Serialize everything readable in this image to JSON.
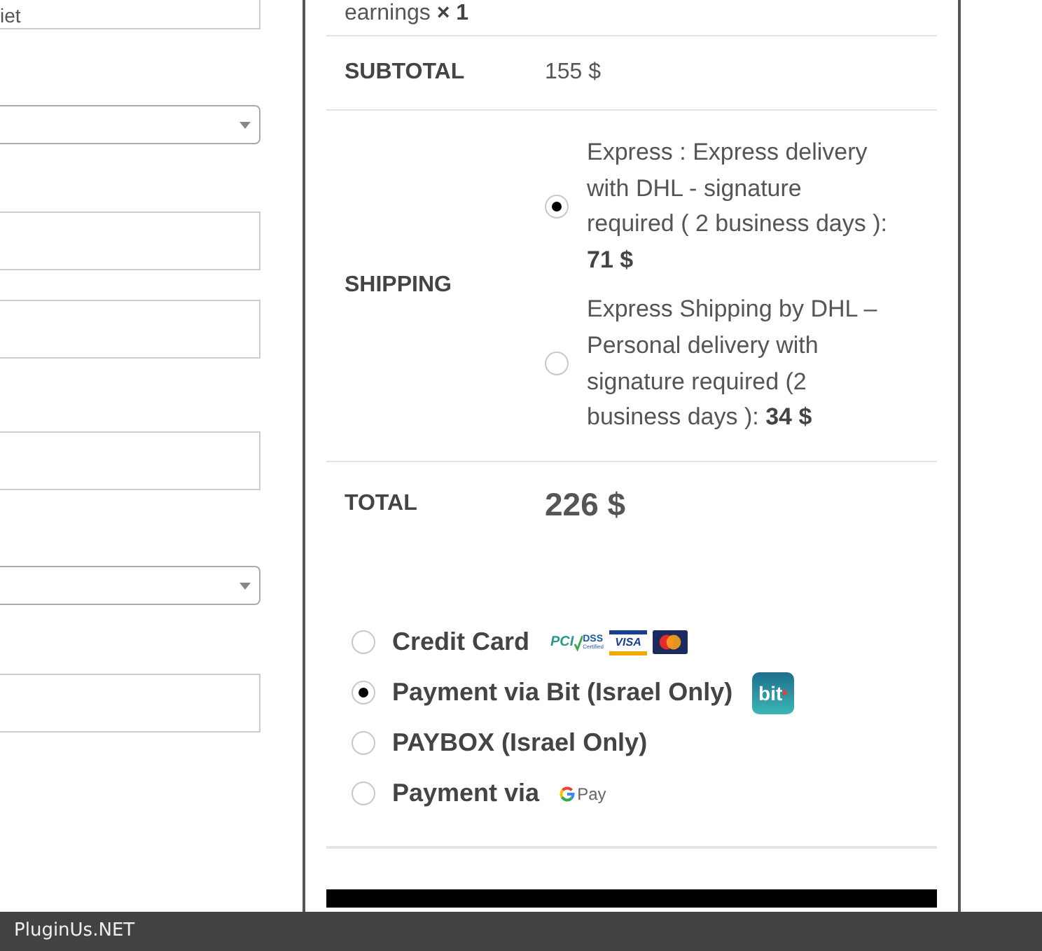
{
  "left_form": {
    "fields": [
      {
        "kind": "input",
        "value": "iet"
      },
      {
        "kind": "select"
      },
      {
        "kind": "input"
      },
      {
        "kind": "input"
      },
      {
        "kind": "input"
      },
      {
        "kind": "select"
      },
      {
        "kind": "input"
      }
    ]
  },
  "order_review": {
    "cart_item": {
      "name": "earnings",
      "quantity": "× 1"
    },
    "subtotal": {
      "label": "SUBTOTAL",
      "value": "155 $"
    },
    "shipping": {
      "label": "SHIPPING",
      "options": [
        {
          "text": "Express : Express delivery with DHL - signature required ( 2 business days ): **71 $**",
          "selected": true
        },
        {
          "text": "Express Shipping by DHL – Personal delivery with signature required (2 business days ): **34 $**",
          "selected": false
        }
      ]
    },
    "total": {
      "label": "TOTAL",
      "value": "226 $"
    }
  },
  "payment_methods": [
    {
      "label": "Credit Card",
      "selected": false,
      "logos": [
        {
          "kind": "pci",
          "text": "PCI",
          "caption": "DSS",
          "subcaption": "Certified"
        },
        {
          "kind": "visa",
          "text": "VISA"
        },
        {
          "kind": "mastercard"
        }
      ]
    },
    {
      "label": "Payment via Bit (Israel Only)",
      "selected": true,
      "logos": [
        {
          "kind": "bit",
          "text": "bit"
        }
      ]
    },
    {
      "label": "PAYBOX (Israel Only)",
      "selected": false
    },
    {
      "label": "Payment via",
      "selected": false,
      "logos": [
        {
          "kind": "gpay",
          "text": "Pay"
        }
      ]
    }
  ],
  "footer_bar": {
    "text": "PluginUs.NET"
  }
}
